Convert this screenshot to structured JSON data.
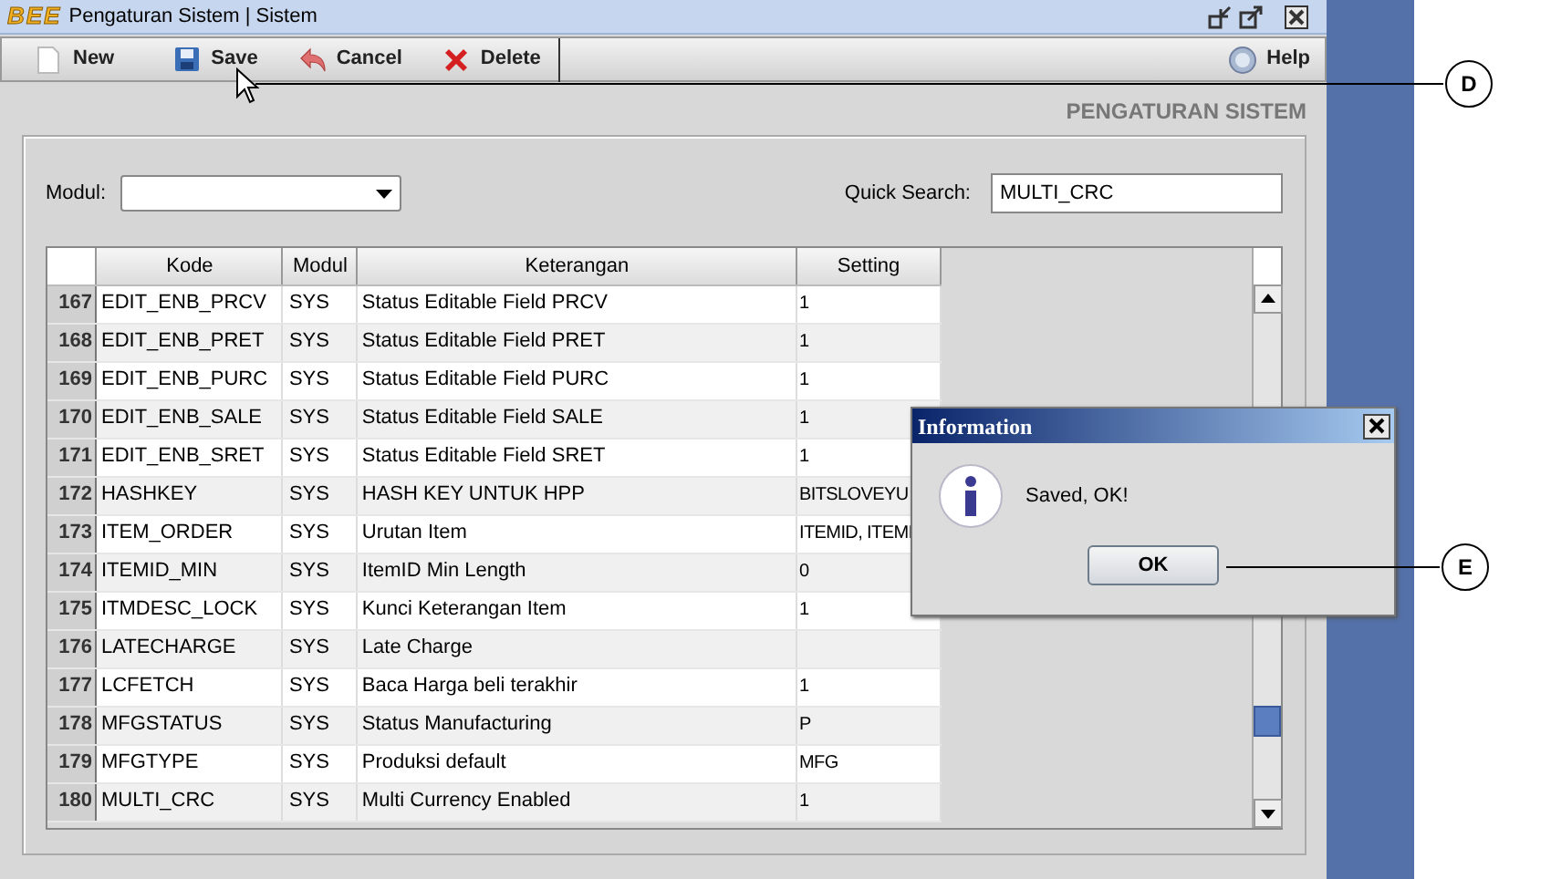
{
  "window": {
    "logo": "BEE",
    "title": "Pengaturan Sistem | Sistem"
  },
  "toolbar": [
    {
      "kind": "new",
      "label": "New"
    },
    {
      "kind": "save",
      "label": "Save"
    },
    {
      "kind": "cancel",
      "label": "Cancel"
    },
    {
      "kind": "delete",
      "label": "Delete"
    },
    {
      "kind": "help",
      "label": "Help"
    }
  ],
  "heading": "PENGATURAN SISTEM",
  "filter": {
    "modul_label": "Modul:",
    "search_label": "Quick Search:",
    "search_value": "MULTI_CRC"
  },
  "table": {
    "columns": [
      "Kode",
      "Modul",
      "Keterangan",
      "Setting"
    ],
    "rows": [
      {
        "no": "167",
        "kode": "EDIT_ENB_PRCV",
        "modul": "SYS",
        "keterangan": "Status Editable Field PRCV",
        "setting": "1"
      },
      {
        "no": "168",
        "kode": "EDIT_ENB_PRET",
        "modul": "SYS",
        "keterangan": "Status Editable Field PRET",
        "setting": "1"
      },
      {
        "no": "169",
        "kode": "EDIT_ENB_PURC",
        "modul": "SYS",
        "keterangan": "Status Editable Field PURC",
        "setting": "1"
      },
      {
        "no": "170",
        "kode": "EDIT_ENB_SALE",
        "modul": "SYS",
        "keterangan": "Status Editable Field SALE",
        "setting": "1"
      },
      {
        "no": "171",
        "kode": "EDIT_ENB_SRET",
        "modul": "SYS",
        "keterangan": "Status Editable Field SRET",
        "setting": "1"
      },
      {
        "no": "172",
        "kode": "HASHKEY",
        "modul": "SYS",
        "keterangan": "HASH KEY UNTUK HPP",
        "setting": "BITSLOVEYU"
      },
      {
        "no": "173",
        "kode": "ITEM_ORDER",
        "modul": "SYS",
        "keterangan": "Urutan Item",
        "setting": "ITEMID, ITEMI"
      },
      {
        "no": "174",
        "kode": "ITEMID_MIN",
        "modul": "SYS",
        "keterangan": "ItemID Min Length",
        "setting": "0"
      },
      {
        "no": "175",
        "kode": "ITMDESC_LOCK",
        "modul": "SYS",
        "keterangan": "Kunci Keterangan Item",
        "setting": "1"
      },
      {
        "no": "176",
        "kode": "LATECHARGE",
        "modul": "SYS",
        "keterangan": "Late Charge"
      },
      {
        "no": "177",
        "kode": "LCFETCH",
        "modul": "SYS",
        "keterangan": "Baca Harga beli terakhir",
        "setting": "1"
      },
      {
        "no": "178",
        "kode": "MFGSTATUS",
        "modul": "SYS",
        "keterangan": "Status Manufacturing",
        "setting": "P"
      },
      {
        "no": "179",
        "kode": "MFGTYPE",
        "modul": "SYS",
        "keterangan": "Produksi default",
        "setting": "MFG"
      },
      {
        "no": "180",
        "kode": "MULTI_CRC",
        "modul": "SYS",
        "keterangan": "Multi Currency Enabled",
        "setting": "1"
      }
    ]
  },
  "dialog": {
    "title": "Information",
    "message": "Saved, OK!",
    "button": "OK"
  },
  "callouts": [
    {
      "label": "D"
    },
    {
      "label": "E"
    }
  ]
}
